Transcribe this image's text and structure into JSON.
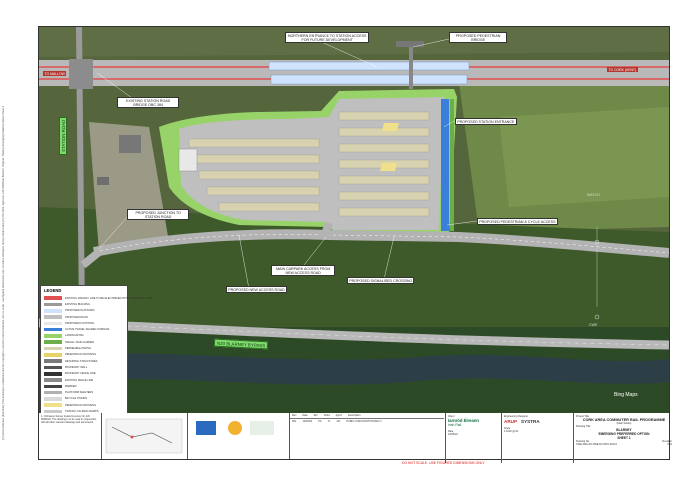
{
  "side_note": "(C) Iarnrod Eireann (Irish Rail). This drawing is confidential and the copyright is vested in Iarnrod Eireann. Do not scale - use figured dimensions only. Contains Ordnance Survey Ireland data (C) OSi 2022. Approval: ASH BRIDGE BAILEY. Original - Blarney Emerging Preferred Option Sheet 1",
  "labels": {
    "to_mallow": "TO MALLOW",
    "to_cork": "TO CORK (KENT)",
    "northern_entrance": "NORTHERN ENTRANCE TO STATION ACCESS FOR FUTURE DEVELOPMENT",
    "proposed_pedestrian_bridge": "PROPOSED PEDESTRIAN BRIDGE",
    "existing_station_road": "EXISTING STATION ROAD BRIDGE OBC 384",
    "proposed_station_entrance": "PROPOSED STATION ENTRANCE",
    "proposed_junction": "PROPOSED JUNCTION TO STATION ROAD",
    "proposed_ped_cycle": "PROPOSED PEDESTRIAN & CYCLE ACCESS",
    "main_carpark_access": "MAIN CARPARK ACCESS FROM NEW ACCESS ROAD",
    "proposed_signalised": "PROPOSED SIGNALISED CROSSING",
    "proposed_new_access": "PROPOSED NEW ACCESS ROAD",
    "station_road": "STATION ROAD",
    "n20": "N20 BLARNEY BYPASS",
    "watch": "WATCH",
    "cwe": "CWE",
    "bing": "Bing Maps"
  },
  "legend": {
    "title": "LEGEND",
    "items": [
      {
        "label": "EXISTING RAILWAY LINE TO BE ELECTRIFIED WITH OVERHEAD LINES",
        "color": "#e05050"
      },
      {
        "label": "EXISTING BUILDING",
        "color": "#9a9a9a"
      },
      {
        "label": "PROPOSED PLATFORM",
        "color": "#cfe3ff"
      },
      {
        "label": "PROPOSED ROAD",
        "color": "#bfbfbf"
      },
      {
        "label": "PROPOSED FOOTPATH",
        "color": "#e8e8e8"
      },
      {
        "label": "ACTIVE TRAVEL SHARED SURFACE",
        "color": "#3a7fd9"
      },
      {
        "label": "LANDSCAPING",
        "color": "#98d36a"
      },
      {
        "label": "SWALE / RAIN GARDEN",
        "color": "#6cae4a"
      },
      {
        "label": "PERMEABLE PAVING",
        "color": "#d8d2b0"
      },
      {
        "label": "PEDESTRIAN CROSSING",
        "color": "#e8d36a"
      },
      {
        "label": "RETAINING STRUCTURES",
        "color": "#7a7a7a"
      },
      {
        "label": "BOUNDARY WALL",
        "color": "#555555"
      },
      {
        "label": "BOUNDARY FENCE LINE",
        "color": "#333333"
      },
      {
        "label": "EXISTING FENCE LINE",
        "color": "#8a8a8a"
      },
      {
        "label": "BARRIER",
        "color": "#444444"
      },
      {
        "label": "PLATFORM SHELTERS",
        "color": "#b0b0b0"
      },
      {
        "label": "BICYCLE STANDS",
        "color": "#d9d9d9"
      },
      {
        "label": "PEDESTRIAN CROSSING",
        "color": "#f0e08a"
      },
      {
        "label": "TRAFFIC CALMING RAMPS",
        "color": "#c9c9c9"
      }
    ]
  },
  "title_block": {
    "notes": "1. Ordnance Survey Ireland Licence No. EN 0045022. The drawing is to be read in conjunction with all other relevant drawings and documents.",
    "rev_headers": [
      "Rev",
      "Date",
      "Drn",
      "Chkd",
      "App'd",
      "Description"
    ],
    "rev_row": [
      "P01",
      "12/05/22",
      "PC",
      "TL",
      "GH",
      "PUBIC CONSULTATION REV 1"
    ],
    "client_label": "Client",
    "client_name": "Iarnród Éireann",
    "client_sub": "Irish Rail",
    "engineering_label": "Engineering Designer",
    "designer": "ARUP",
    "designer2": "SYSTRA",
    "project_label": "Project Title",
    "project_title": "CORK AREA COMMUTER RAIL PROGRAMME",
    "project_sub": "(Main Works)",
    "drawing_label": "Drawing Title",
    "drawing_title_1": "BLARNEY",
    "drawing_title_2": "EMERGING PREFERRED OPTION",
    "drawing_title_3": "SHEET 1",
    "date_label": "Date",
    "date_value": "12/05/22",
    "scale_label": "Scale",
    "scale_value": "1:1000 @ A1",
    "drawing_number_label": "Drawing No.",
    "drawing_number": "CWE-ARA-IPL-BNE-DU-PRO-01001",
    "revision_label": "Revision",
    "revision_value": "P01",
    "do_not_scale": "DO NOT SCALE. USE FIGURED DIMENSIONS ONLY"
  }
}
